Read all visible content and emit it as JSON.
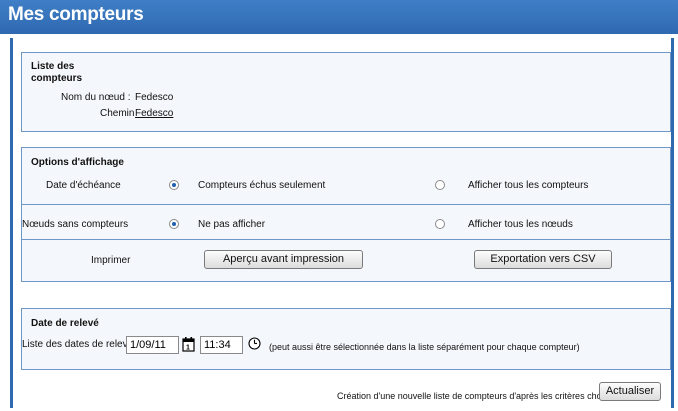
{
  "header": {
    "title": "Mes compteurs"
  },
  "list_panel": {
    "heading_line1": "Liste des",
    "heading_line2": "compteurs",
    "node_name_label": "Nom du nœud :",
    "node_name_value": "Fedesco",
    "path_label": "Chemin",
    "path_link": "Fedesco"
  },
  "options_panel": {
    "heading": "Options d'affichage",
    "due_date": {
      "label": "Date d'échéance",
      "option1": "Compteurs échus seulement",
      "option1_selected": true,
      "option2": "Afficher tous les compteurs",
      "option2_selected": false
    },
    "nodes_without_meters": {
      "label": "Nœuds sans compteurs",
      "option1": "Ne pas afficher",
      "option1_selected": true,
      "option2": "Afficher tous les nœuds",
      "option2_selected": false
    },
    "print": {
      "label": "Imprimer",
      "preview_button": "Aperçu avant impression",
      "export_button": "Exportation vers CSV"
    }
  },
  "reading_panel": {
    "heading": "Date de relevé",
    "dates_label": "Liste des dates de relevé",
    "date_value": "1/09/11",
    "time_value": "11:34",
    "note": "(peut aussi être sélectionnée dans la liste séparément pour chaque compteur)"
  },
  "footer": {
    "text": "Création d'une nouvelle liste de compteurs d'après les critères choisis.",
    "refresh_button": "Actualiser"
  }
}
